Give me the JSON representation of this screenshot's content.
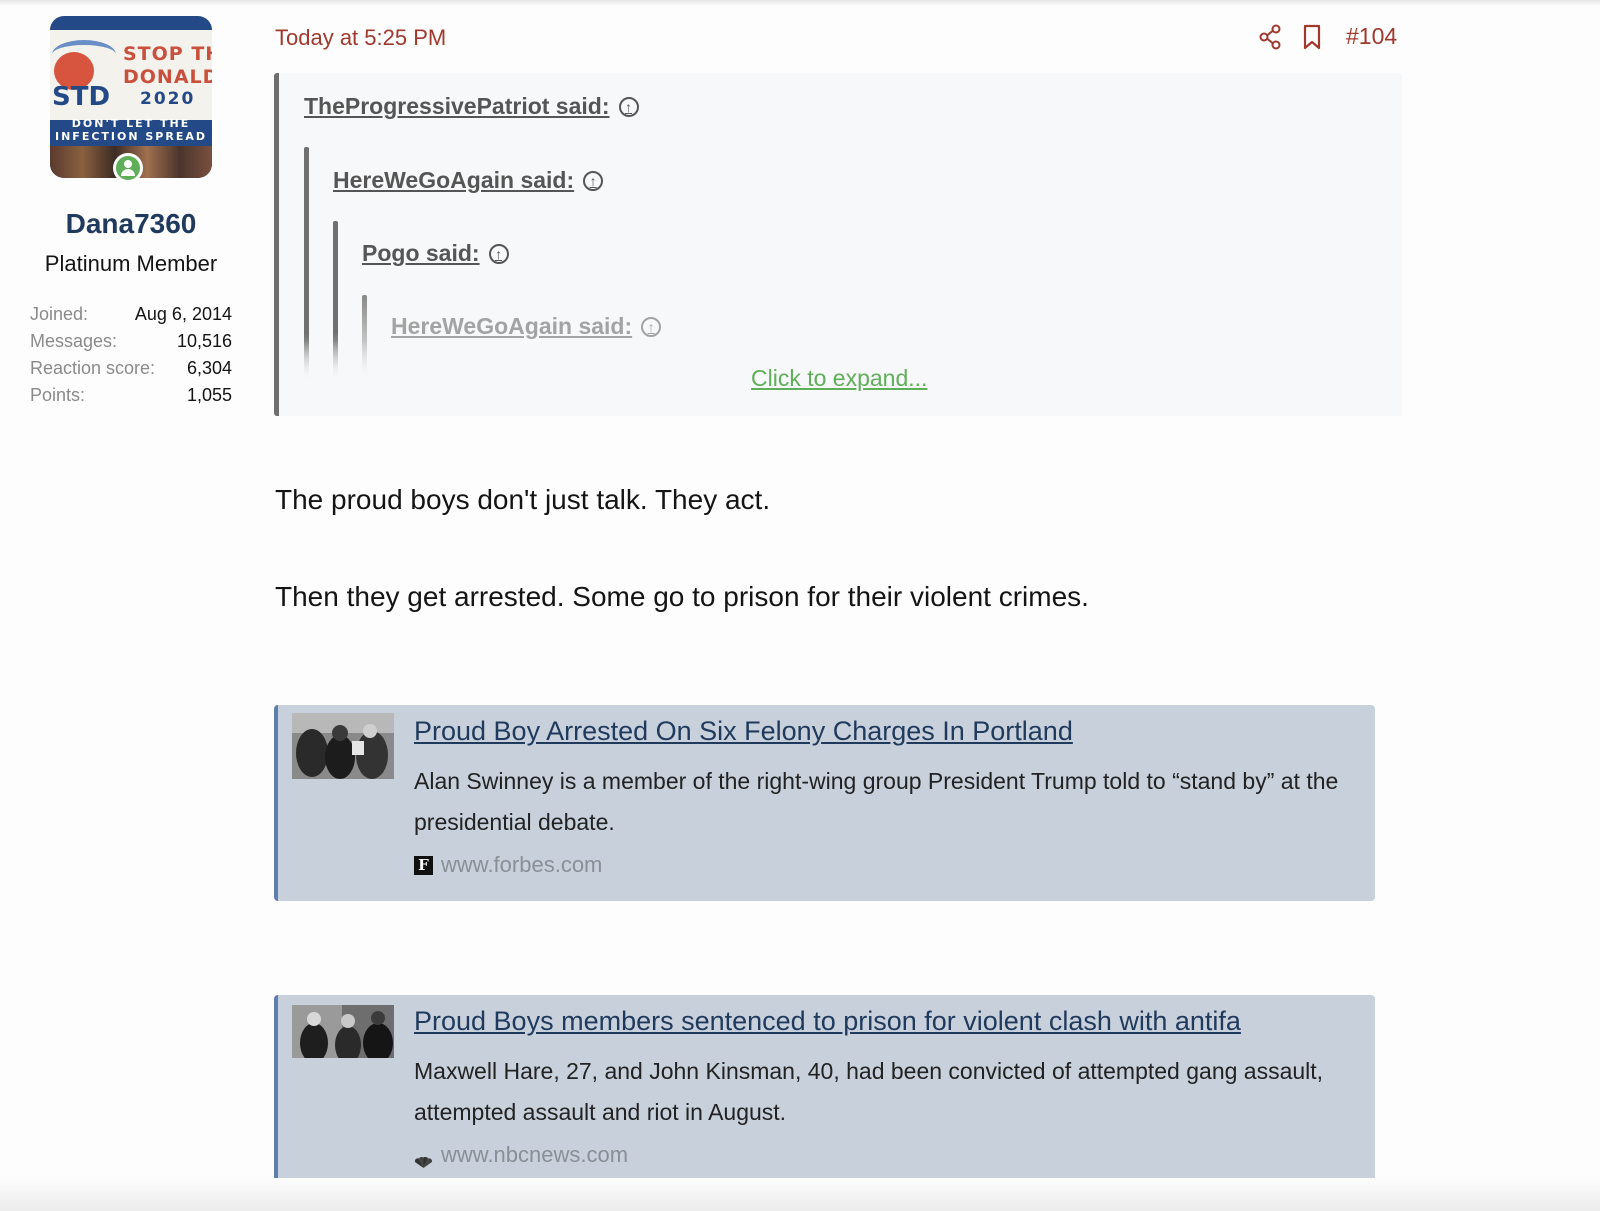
{
  "user": {
    "name": "Dana7360",
    "title": "Platinum Member",
    "avatar_text": {
      "line1": "STOP THE",
      "line2": "DONALD",
      "brand": "STD",
      "year": "2020",
      "tagline1": "DON'T LET THE",
      "tagline2": "INFECTION SPREAD"
    },
    "stats": [
      {
        "label": "Joined:",
        "value": "Aug 6, 2014"
      },
      {
        "label": "Messages:",
        "value": "10,516"
      },
      {
        "label": "Reaction score:",
        "value": "6,304"
      },
      {
        "label": "Points:",
        "value": "1,055"
      }
    ]
  },
  "post": {
    "time": "Today at 5:25 PM",
    "number": "#104",
    "icons": {
      "share": "share-icon",
      "bookmark": "bookmark-icon"
    },
    "quotes": [
      {
        "author": "TheProgressivePatriot said:"
      },
      {
        "author": "HereWeGoAgain said:"
      },
      {
        "author": "Pogo said:"
      },
      {
        "author": "HereWeGoAgain said:"
      }
    ],
    "expand_label": "Click to expand...",
    "paragraphs": [
      "The proud boys don't just talk. They act.",
      "Then they get arrested. Some go to prison for their violent crimes."
    ],
    "links": [
      {
        "title": "Proud Boy Arrested On Six Felony Charges In Portland",
        "description": "Alan Swinney is a member of the right-wing group President Trump told to “stand by” at the presidential debate.",
        "source": "www.forbes.com",
        "favicon_letter": "F"
      },
      {
        "title": "Proud Boys members sentenced to prison for violent clash with antifa",
        "description": "Maxwell Hare, 27, and John Kinsman, 40, had been convicted of attempted gang assault, attempted assault and riot in August.",
        "source": "www.nbcnews.com"
      }
    ]
  },
  "colors": {
    "accent": "#a0392d",
    "username": "#1f3a5c",
    "online": "#5fae58",
    "expand": "#5fae58",
    "card_bg": "#c8d0dc",
    "card_border": "#5c7fae"
  }
}
